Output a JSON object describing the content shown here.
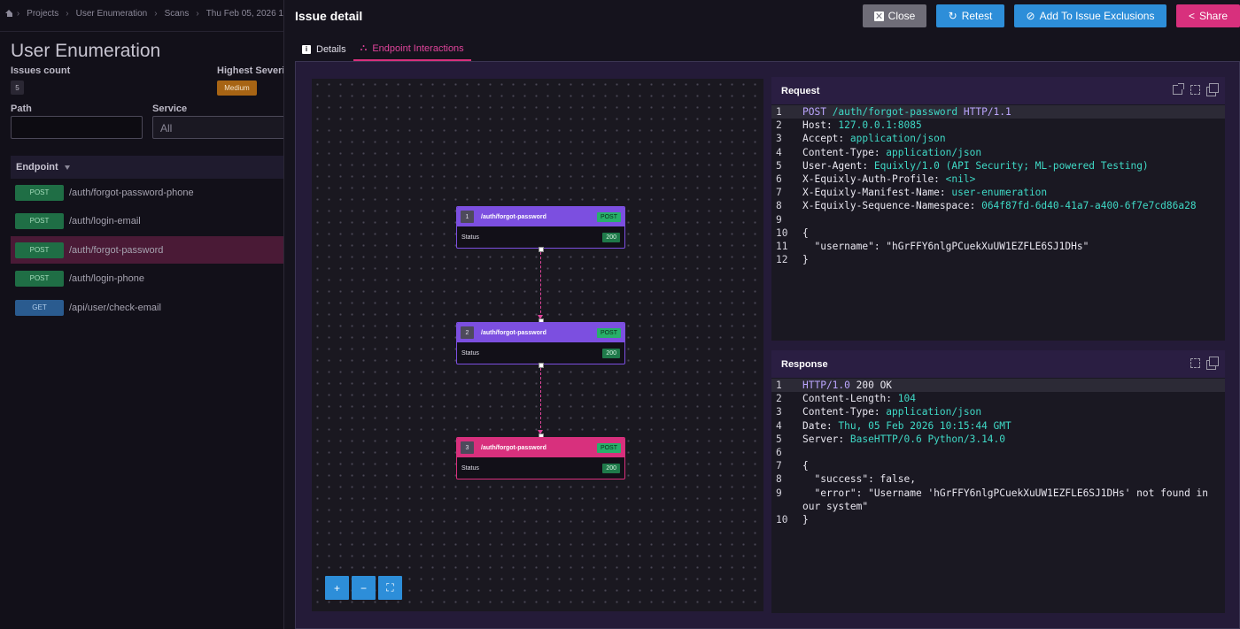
{
  "background": {
    "breadcrumbs": [
      "Projects",
      "User Enumeration",
      "Scans",
      "Thu Feb 05, 2026 1"
    ],
    "title": "User Enumeration",
    "issues_count_label": "Issues count",
    "issues_count": "5",
    "highest_severity_label": "Highest Severit",
    "highest_severity": "Medium",
    "path_label": "Path",
    "path_value": "",
    "service_label": "Service",
    "service_value": "All",
    "endpoint_header": "Endpoint",
    "endpoints": [
      {
        "method": "POST",
        "path": "/auth/forgot-password-phone"
      },
      {
        "method": "POST",
        "path": "/auth/login-email"
      },
      {
        "method": "POST",
        "path": "/auth/forgot-password"
      },
      {
        "method": "POST",
        "path": "/auth/login-phone"
      },
      {
        "method": "GET",
        "path": "/api/user/check-email"
      }
    ]
  },
  "modal": {
    "title": "Issue detail",
    "buttons": {
      "close": "Close",
      "retest": "Retest",
      "exclusions": "Add To Issue Exclusions",
      "share": "Share"
    },
    "tabs": {
      "details": "Details",
      "interactions": "Endpoint Interactions"
    }
  },
  "flow": {
    "status_label": "Status",
    "nodes": [
      {
        "num": "1",
        "path": "/auth/forgot-password",
        "method": "POST",
        "status": "200"
      },
      {
        "num": "2",
        "path": "/auth/forgot-password",
        "method": "POST",
        "status": "200"
      },
      {
        "num": "3",
        "path": "/auth/forgot-password",
        "method": "POST",
        "status": "200"
      }
    ],
    "controls": {
      "zoom_in": "+",
      "zoom_out": "−",
      "fit": "⛶"
    }
  },
  "request": {
    "title": "Request",
    "lines": [
      {
        "n": "1",
        "parts": [
          [
            "k",
            "POST "
          ],
          [
            "v",
            "/auth/forgot-password "
          ],
          [
            "k",
            "HTTP/1.1"
          ]
        ]
      },
      {
        "n": "2",
        "parts": [
          [
            "t",
            "Host: "
          ],
          [
            "v",
            "127.0.0.1:8085"
          ]
        ]
      },
      {
        "n": "3",
        "parts": [
          [
            "t",
            "Accept: "
          ],
          [
            "v",
            "application/json"
          ]
        ]
      },
      {
        "n": "4",
        "parts": [
          [
            "t",
            "Content-Type: "
          ],
          [
            "v",
            "application/json"
          ]
        ]
      },
      {
        "n": "5",
        "parts": [
          [
            "t",
            "User-Agent: "
          ],
          [
            "v",
            "Equixly/1.0 (API Security; ML-powered Testing)"
          ]
        ]
      },
      {
        "n": "6",
        "parts": [
          [
            "t",
            "X-Equixly-Auth-Profile: "
          ],
          [
            "v",
            "<nil>"
          ]
        ]
      },
      {
        "n": "7",
        "parts": [
          [
            "t",
            "X-Equixly-Manifest-Name: "
          ],
          [
            "v",
            "user-enumeration"
          ]
        ]
      },
      {
        "n": "8",
        "parts": [
          [
            "t",
            "X-Equixly-Sequence-Namespace: "
          ],
          [
            "v",
            "064f87fd-6d40-41a7-a400-6f7e7cd86a28"
          ]
        ]
      },
      {
        "n": "9",
        "parts": []
      },
      {
        "n": "10",
        "parts": [
          [
            "t",
            "{"
          ]
        ]
      },
      {
        "n": "11",
        "parts": [
          [
            "t",
            "  \"username\": \"hGrFFY6nlgPCuekXuUW1EZFLE6SJ1DHs\""
          ]
        ]
      },
      {
        "n": "12",
        "parts": [
          [
            "t",
            "}"
          ]
        ]
      }
    ]
  },
  "response": {
    "title": "Response",
    "lines": [
      {
        "n": "1",
        "parts": [
          [
            "k",
            "HTTP/1.0 "
          ],
          [
            "t",
            "200 OK"
          ]
        ]
      },
      {
        "n": "2",
        "parts": [
          [
            "t",
            "Content-Length: "
          ],
          [
            "v",
            "104"
          ]
        ]
      },
      {
        "n": "3",
        "parts": [
          [
            "t",
            "Content-Type: "
          ],
          [
            "v",
            "application/json"
          ]
        ]
      },
      {
        "n": "4",
        "parts": [
          [
            "t",
            "Date: "
          ],
          [
            "v",
            "Thu, 05 Feb 2026 10:15:44 GMT"
          ]
        ]
      },
      {
        "n": "5",
        "parts": [
          [
            "t",
            "Server: "
          ],
          [
            "v",
            "BaseHTTP/0.6 Python/3.14.0"
          ]
        ]
      },
      {
        "n": "6",
        "parts": []
      },
      {
        "n": "7",
        "parts": [
          [
            "t",
            "{"
          ]
        ]
      },
      {
        "n": "8",
        "parts": [
          [
            "t",
            "  \"success\": false,"
          ]
        ]
      },
      {
        "n": "9",
        "parts": [
          [
            "t",
            "  \"error\": \"Username 'hGrFFY6nlgPCuekXuUW1EZFLE6SJ1DHs' not found in"
          ]
        ]
      },
      {
        "n": "",
        "parts": [
          [
            "t",
            "our system\""
          ]
        ]
      },
      {
        "n": "10",
        "parts": [
          [
            "t",
            "}"
          ]
        ]
      }
    ]
  },
  "colors": {
    "accent_pink": "#d8307d",
    "accent_blue": "#2d8ed9",
    "node_purple": "#7c4fe0",
    "code_key": "#bca6ff",
    "code_value": "#3fd9c6"
  }
}
